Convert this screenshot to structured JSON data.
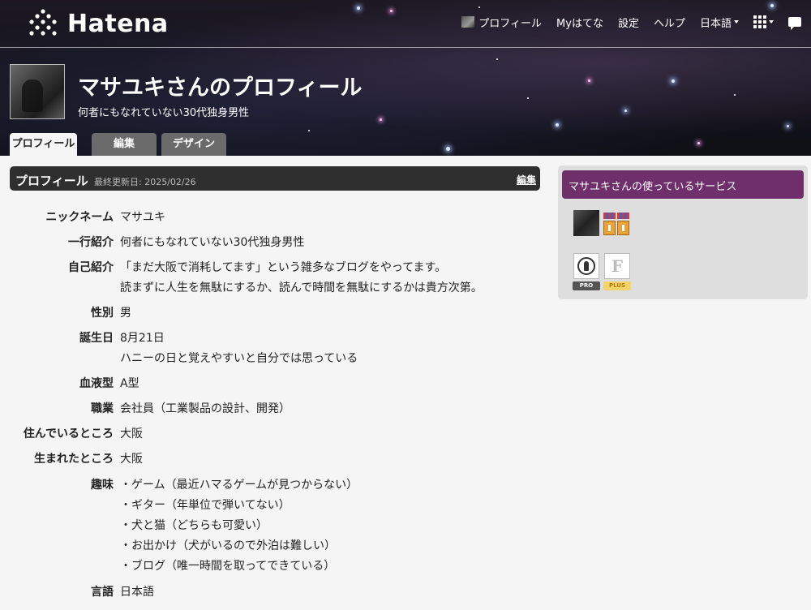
{
  "header": {
    "logo_text": "Hatena",
    "nav": {
      "profile": "プロフィール",
      "my_hatena": "Myはてな",
      "settings": "設定",
      "help": "ヘルプ",
      "language": "日本語"
    },
    "title": "マサユキさんのプロフィール",
    "subtitle": "何者にもなれていない30代独身男性"
  },
  "tabs": [
    {
      "label": "プロフィール",
      "active": true
    },
    {
      "label": "編集",
      "active": false
    },
    {
      "label": "デザイン",
      "active": false
    }
  ],
  "section": {
    "title": "プロフィール",
    "updated": "最終更新日: 2025/02/26",
    "edit_label": "編集"
  },
  "profile_rows": [
    {
      "label": "ニックネーム",
      "lines": [
        "マサユキ"
      ]
    },
    {
      "label": "一行紹介",
      "lines": [
        "何者にもなれていない30代独身男性"
      ]
    },
    {
      "label": "自己紹介",
      "lines": [
        "「まだ大阪で消耗してます」という雑多なブログをやってます。",
        "読まずに人生を無駄にするか、読んで時間を無駄にするかは貴方次第。"
      ]
    },
    {
      "label": "性別",
      "lines": [
        "男"
      ]
    },
    {
      "label": "誕生日",
      "lines": [
        "8月21日",
        "ハニーの日と覚えやすいと自分では思っている"
      ]
    },
    {
      "label": "血液型",
      "lines": [
        "A型"
      ]
    },
    {
      "label": "職業",
      "lines": [
        "会社員（工業製品の設計、開発）"
      ]
    },
    {
      "label": "住んでいるところ",
      "lines": [
        "大阪"
      ]
    },
    {
      "label": "生まれたところ",
      "lines": [
        "大阪"
      ]
    },
    {
      "label": "趣味",
      "lines": [
        "・ゲーム（最近ハマるゲームが見つからない）",
        "・ギター（年単位で弾いてない）",
        "・犬と猫（どちらも可愛い）",
        "・お出かけ（犬がいるので外泊は難しい）",
        "・ブログ（唯一時間を取ってできている）"
      ]
    },
    {
      "label": "言語",
      "lines": [
        "日本語"
      ]
    }
  ],
  "sidebar": {
    "title": "マサユキさんの使っているサービス",
    "badges": {
      "pro": "PRO",
      "plus": "PLUS"
    }
  },
  "colors": {
    "header_bg": "#15141d",
    "section_head": "#2f2f2f",
    "sidebar_head": "#6e2f6b",
    "sidebar_bg": "#dedede",
    "page_bg": "#f5f5f5"
  }
}
